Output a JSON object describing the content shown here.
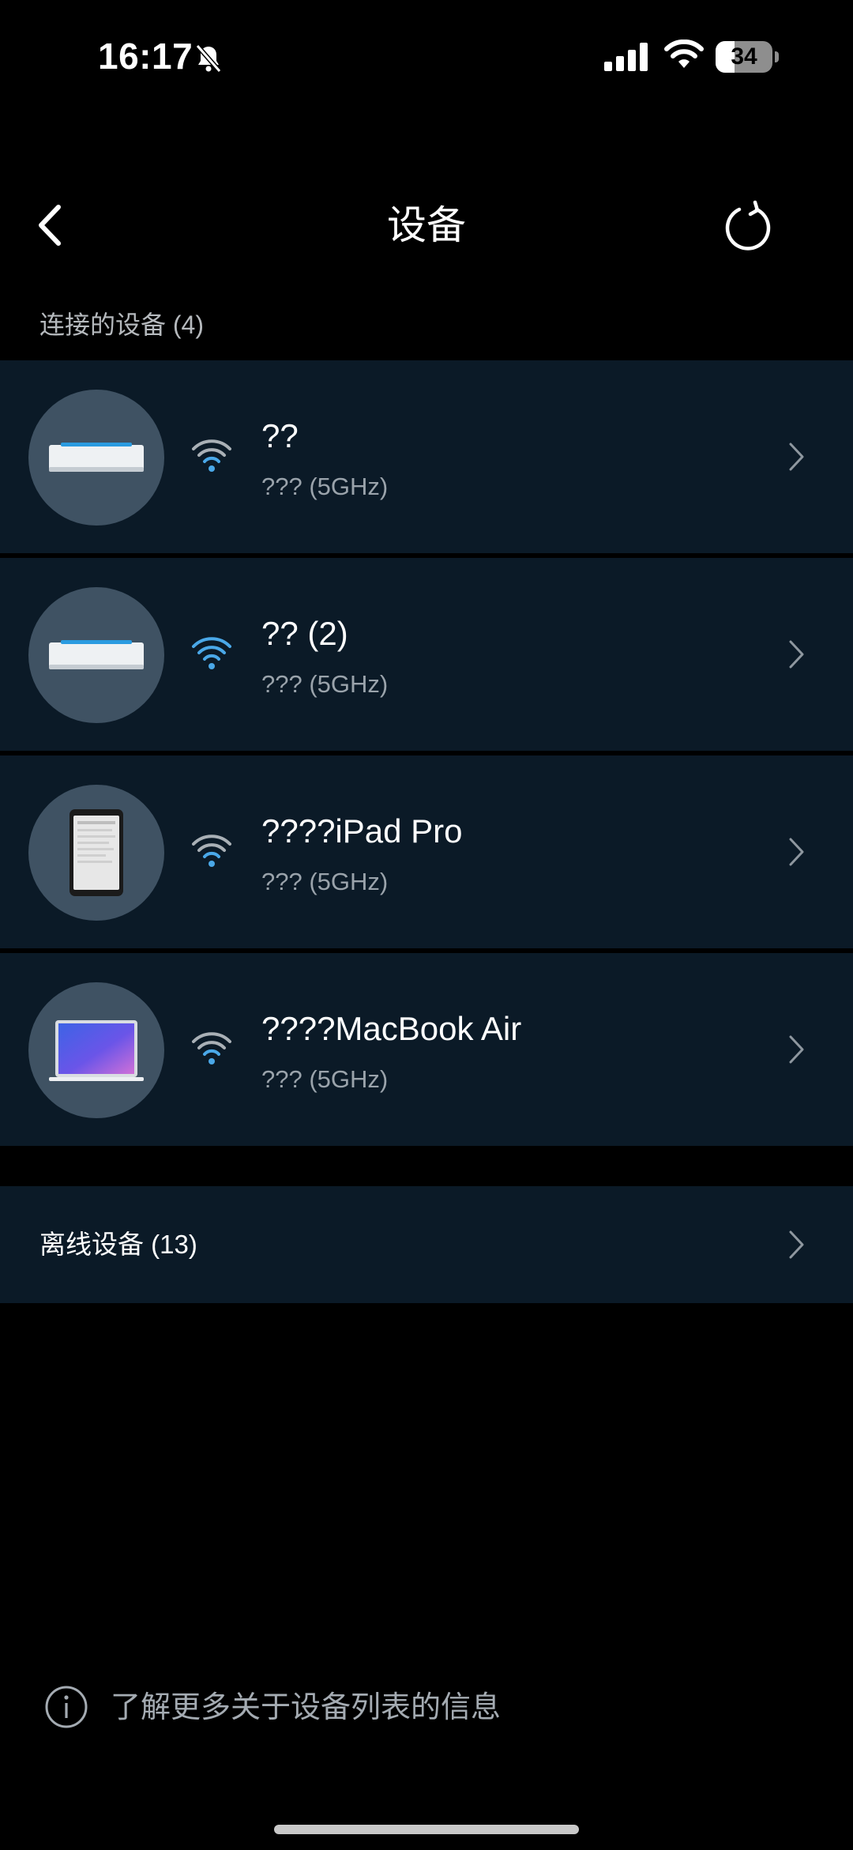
{
  "status_bar": {
    "time": "16:17",
    "battery_level": "34",
    "battery_fraction": 0.34,
    "icons": [
      "bell-slash-icon",
      "cellular-signal-icon",
      "wifi-icon",
      "battery-icon"
    ]
  },
  "nav": {
    "title": "设备",
    "back_icon": "chevron-left-icon",
    "refresh_icon": "refresh-icon"
  },
  "connected": {
    "header": "连接的设备  (4)",
    "devices": [
      {
        "name": "??",
        "band": "??? (5GHz)",
        "icon": "router-node-icon",
        "wifi_icon": "wifi-icon"
      },
      {
        "name": "?? (2)",
        "band": "??? (5GHz)",
        "icon": "router-node-icon",
        "wifi_icon": "wifi-icon"
      },
      {
        "name": "????iPad Pro",
        "band": "??? (5GHz)",
        "icon": "tablet-icon",
        "wifi_icon": "wifi-icon"
      },
      {
        "name": "????MacBook Air",
        "band": "??? (5GHz)",
        "icon": "laptop-icon",
        "wifi_icon": "wifi-icon"
      }
    ]
  },
  "offline": {
    "label": "离线设备  (13)"
  },
  "footer": {
    "info_text": "了解更多关于设备列表的信息",
    "info_icon": "info-circle-icon"
  },
  "colors": {
    "background": "#000000",
    "row_background": "#0b1a27",
    "avatar_background": "#3f5263",
    "wifi_accent": "#4aa8e8",
    "wifi_dim": "#a9b0b6",
    "secondary_text": "#9aa3ab"
  }
}
